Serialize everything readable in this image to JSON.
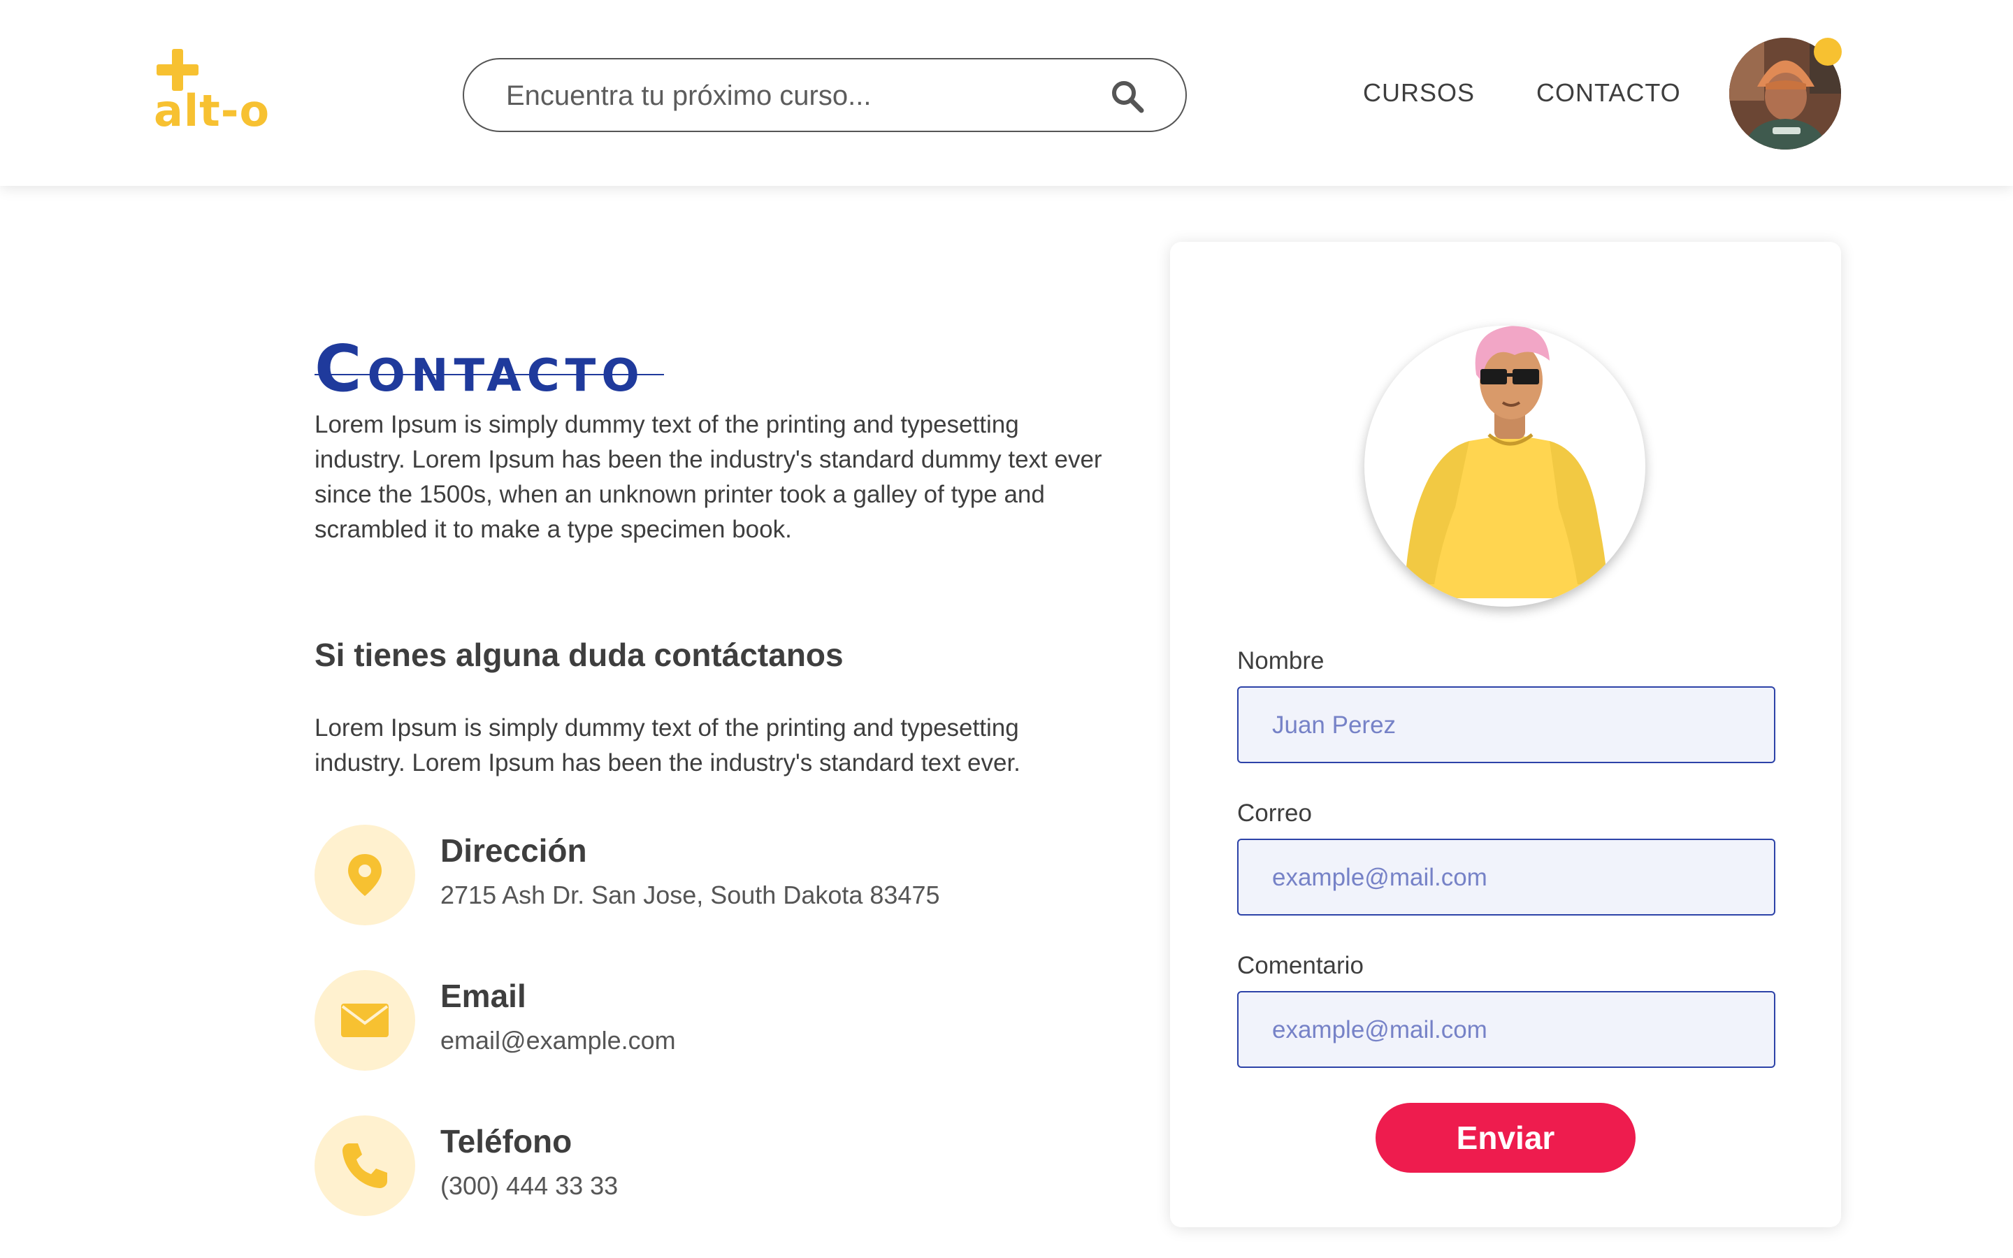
{
  "brand": {
    "logo_text": "alt-o",
    "accent_color": "#f7c131"
  },
  "header": {
    "search_placeholder": "Encuentra tu próximo curso...",
    "nav": {
      "cursos": "CURSOS",
      "contacto": "CONTACTO"
    }
  },
  "main": {
    "title": "Contacto",
    "intro": "Lorem Ipsum is simply dummy text of the printing and typesetting industry. Lorem Ipsum has been the industry's standard dummy text ever since the 1500s, when an unknown printer took a galley of type and scrambled it to make a type specimen book.",
    "subtitle": "Si tienes alguna duda contáctanos",
    "description": "Lorem Ipsum is simply dummy text of the printing and typesetting industry. Lorem Ipsum has been the industry's standard  text ever.",
    "info": [
      {
        "icon": "location-pin-icon",
        "title": "Dirección",
        "value": "2715 Ash Dr. San Jose, South Dakota 83475"
      },
      {
        "icon": "mail-icon",
        "title": "Email",
        "value": "email@example.com"
      },
      {
        "icon": "phone-icon",
        "title": "Teléfono",
        "value": "(300) 444 33 33"
      }
    ]
  },
  "form": {
    "fields": [
      {
        "label": "Nombre",
        "placeholder": "Juan Perez"
      },
      {
        "label": "Correo",
        "placeholder": "example@mail.com"
      },
      {
        "label": "Comentario",
        "placeholder": "example@mail.com"
      }
    ],
    "submit_label": "Enviar",
    "submit_color": "#ee1c4e",
    "field_border_color": "#2d43a8",
    "title_color": "#1f3a9c"
  }
}
